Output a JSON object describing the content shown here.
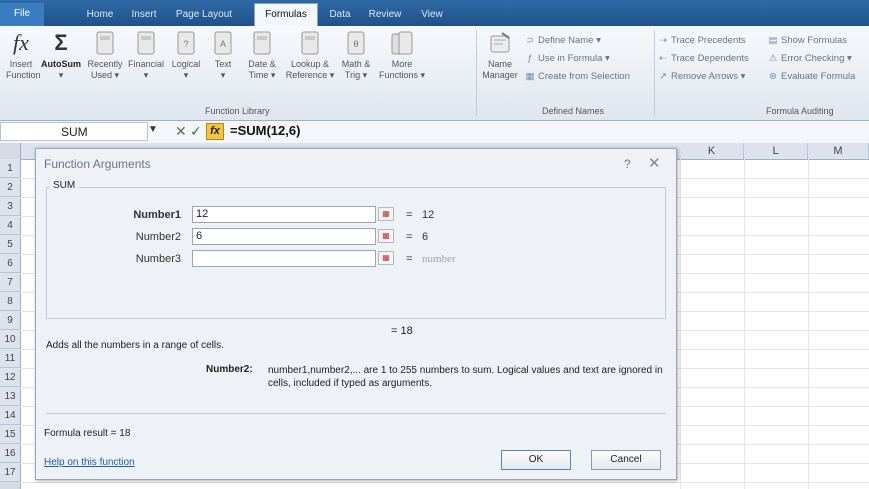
{
  "tabs": [
    "File",
    "Home",
    "Insert",
    "Page Layout",
    "Formulas",
    "Data",
    "Review",
    "View"
  ],
  "ribbon": {
    "insert_function": {
      "line1": "Insert",
      "line2": "Function"
    },
    "function_library": {
      "buttons": [
        {
          "line1": "AutoSum",
          "line2": "▾"
        },
        {
          "line1": "Recently",
          "line2": "Used ▾"
        },
        {
          "line1": "Financial",
          "line2": "▾"
        },
        {
          "line1": "Logical",
          "line2": "▾"
        },
        {
          "line1": "Text",
          "line2": "▾"
        },
        {
          "line1": "Date &",
          "line2": "Time ▾"
        },
        {
          "line1": "Lookup &",
          "line2": "Reference ▾"
        },
        {
          "line1": "Math &",
          "line2": "Trig ▾"
        },
        {
          "line1": "More",
          "line2": "Functions ▾"
        }
      ],
      "label": "Function Library"
    },
    "defined_names": {
      "name_manager": {
        "line1": "Name",
        "line2": "Manager"
      },
      "define_name": "Define Name ▾",
      "use_in_formula": "Use in Formula ▾",
      "create_from_selection": "Create from Selection",
      "label": "Defined Names"
    },
    "formula_auditing": {
      "trace_precedents": "Trace Precedents",
      "trace_dependents": "Trace Dependents",
      "remove_arrows": "Remove Arrows ▾",
      "show_formulas": "Show Formulas",
      "error_checking": "Error Checking ▾",
      "evaluate_formula": "Evaluate Formula",
      "label": "Formula Auditing"
    }
  },
  "formula_bar": {
    "name_box": "SUM",
    "formula": "=SUM(12,6)"
  },
  "sheet": {
    "columns": [
      "K",
      "L",
      "M"
    ],
    "rows": [
      "1",
      "2",
      "3",
      "4",
      "5",
      "6",
      "7",
      "8",
      "9",
      "10",
      "11",
      "12",
      "13",
      "14",
      "15",
      "16",
      "17"
    ]
  },
  "dialog": {
    "title": "Function Arguments",
    "help_glyph": "?",
    "close_glyph": "✕",
    "function_name": "SUM",
    "arguments": [
      {
        "label": "Number1",
        "value": "12",
        "result": "12",
        "bold": true
      },
      {
        "label": "Number2",
        "value": "6",
        "result": "6",
        "bold": false
      },
      {
        "label": "Number3",
        "value": "",
        "result": "number",
        "bold": false
      }
    ],
    "equals": "=",
    "total_result": "= 18",
    "function_description": "Adds all the numbers in a range of cells.",
    "arg_desc_label": "Number2:",
    "arg_desc_text": "number1,number2,... are 1 to 255 numbers to sum. Logical values and text are ignored in cells, included if typed as arguments.",
    "formula_result": "Formula result =  18",
    "help_link": "Help on this function",
    "ok_label": "OK",
    "cancel_label": "Cancel"
  }
}
